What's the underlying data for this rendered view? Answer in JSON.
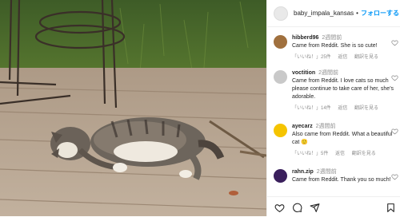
{
  "header": {
    "username": "baby_impala_kansas",
    "dot": "•",
    "follow_label": "フォローする"
  },
  "comments": [
    {
      "user": "hibberd96",
      "time": "2週間前",
      "text": "Came from Reddit. She is so cute!",
      "likes": "「いいね！」25件",
      "reply": "返信",
      "translate": "翻訳を見る",
      "avatar_color": "#a0703e"
    },
    {
      "user": "voctition",
      "time": "2週間前",
      "text": "Came from Reddit. I love cats so much please continue to take care of her, she's adorable.",
      "likes": "「いいね！」14件",
      "reply": "返信",
      "translate": "翻訳を見る",
      "avatar_color": "#c9c9c9"
    },
    {
      "user": "ayecarz",
      "time": "2週間前",
      "text": "Also came from Reddit. What a beautiful cat 🙂",
      "likes": "「いいね！」5件",
      "reply": "返信",
      "translate": "翻訳を見る",
      "avatar_color": "#f5c400"
    },
    {
      "user": "rahn.zip",
      "time": "2週間前",
      "text": "Came from Reddit. Thank you so much!",
      "likes": "",
      "reply": "",
      "translate": "",
      "avatar_color": "#3a1f5c"
    }
  ],
  "icons": {
    "heart": "heart-icon",
    "comment": "comment-icon",
    "share": "share-icon",
    "bookmark": "bookmark-icon"
  }
}
